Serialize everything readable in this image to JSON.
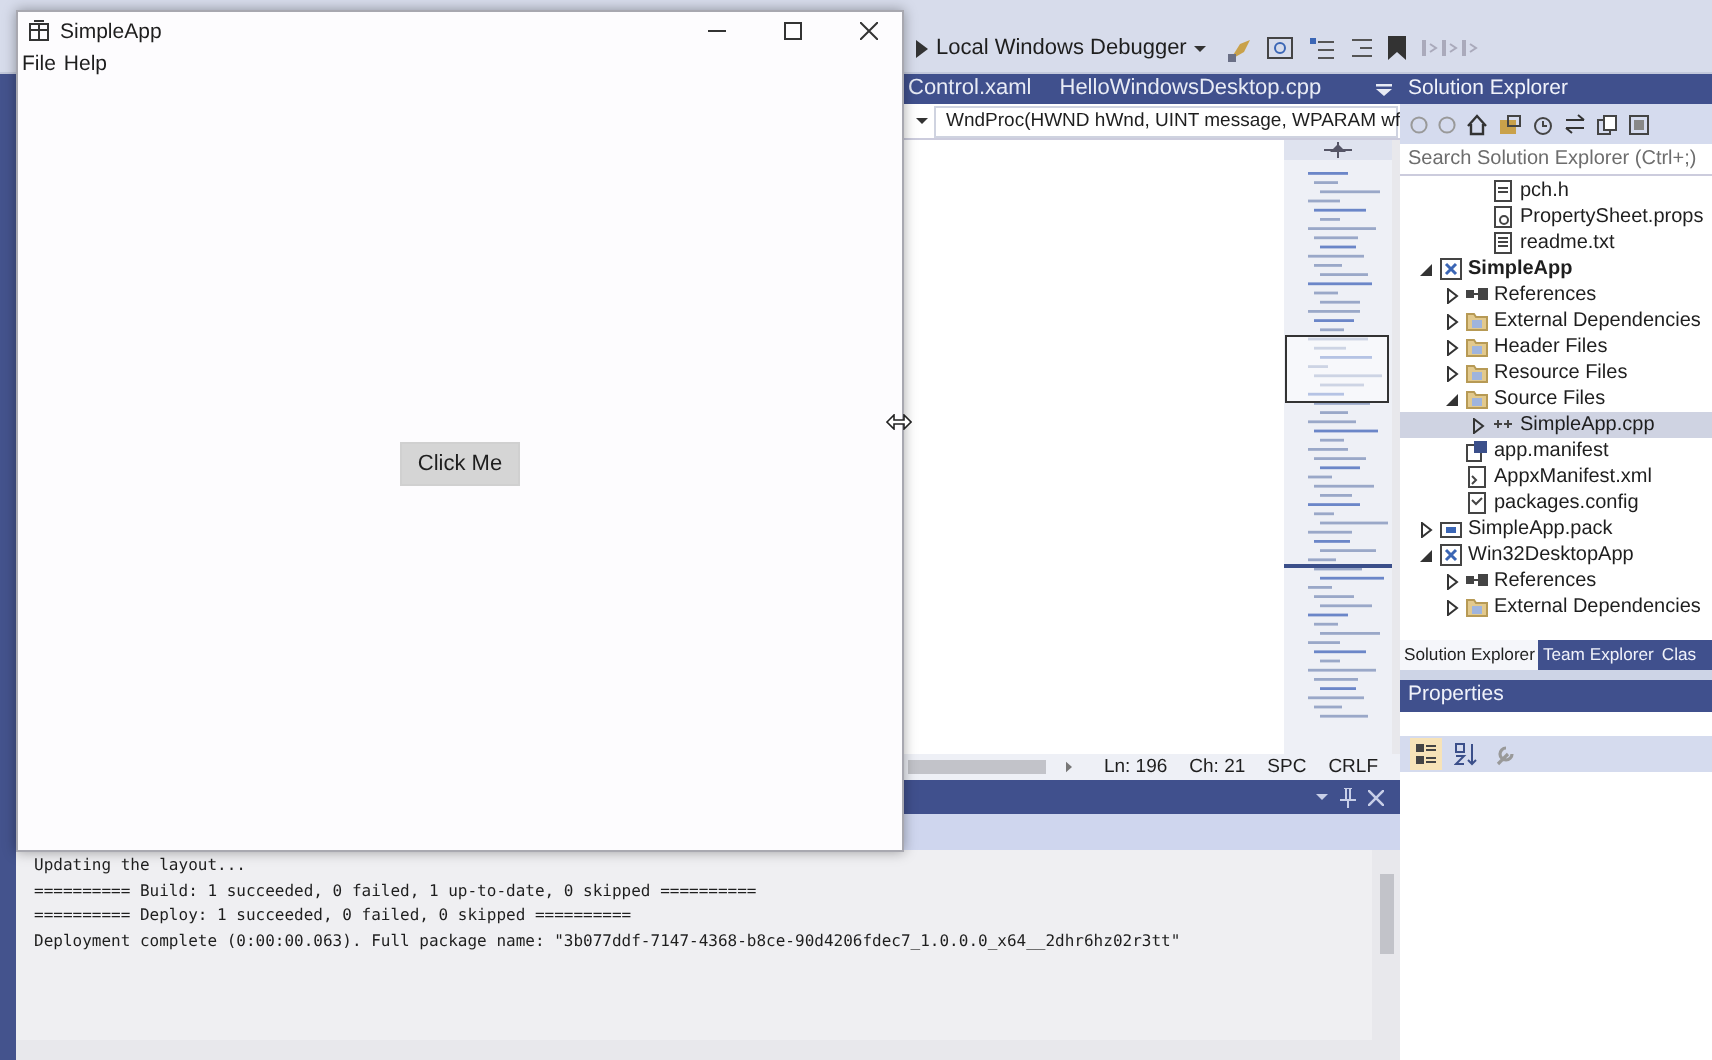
{
  "vs_toolbar": {
    "debugger": "Local Windows Debugger"
  },
  "editor": {
    "tabs": [
      {
        "label": "Control.xaml",
        "selected": false
      },
      {
        "label": "HelloWindowsDesktop.cpp",
        "selected": false
      }
    ],
    "function_dropdown": "WndProc(HWND hWnd, UINT message, WPARAM wf",
    "status": {
      "line": "Ln: 196",
      "column": "Ch: 21",
      "indent": "SPC",
      "line_ending": "CRLF"
    }
  },
  "output": {
    "lines": [
      "Updating the layout...",
      "========== Build: 1 succeeded, 0 failed, 1 up-to-date, 0 skipped ==========",
      "========== Deploy: 1 succeeded, 0 failed, 0 skipped ==========",
      "Deployment complete (0:00:00.063). Full package name: \"3b077ddf-7147-4368-b8ce-90d4206fdec7_1.0.0.0_x64__2dhr6hz02r3tt\""
    ]
  },
  "solution_explorer": {
    "title": "Solution Explorer",
    "search": {
      "placeholder": "Search Solution Explorer (Ctrl+;)"
    },
    "continued_items": [
      {
        "label": "pch.h",
        "kind": "header",
        "selected": false
      },
      {
        "label": "PropertySheet.props",
        "kind": "props",
        "selected": false
      },
      {
        "label": "readme.txt",
        "kind": "text",
        "selected": false
      }
    ],
    "items": [
      {
        "label": "SimpleApp",
        "kind": "project",
        "bold": true,
        "expanded": true,
        "selected": false,
        "children": [
          {
            "label": "References",
            "kind": "references",
            "expanded": false,
            "selected": false
          },
          {
            "label": "External Dependencies",
            "kind": "folder",
            "expanded": false,
            "selected": false
          },
          {
            "label": "Header Files",
            "kind": "folder",
            "expanded": false,
            "selected": false
          },
          {
            "label": "Resource Files",
            "kind": "folder",
            "expanded": false,
            "selected": false
          },
          {
            "label": "Source Files",
            "kind": "folder",
            "expanded": true,
            "selected": false,
            "children": [
              {
                "label": "SimpleApp.cpp",
                "kind": "cpp",
                "expanded": false,
                "selected": true
              }
            ]
          },
          {
            "label": "app.manifest",
            "kind": "manifest",
            "selected": false
          },
          {
            "label": "AppxManifest.xml",
            "kind": "xml",
            "selected": false
          },
          {
            "label": "packages.config",
            "kind": "config",
            "selected": false
          }
        ]
      },
      {
        "label": "SimpleApp.pack",
        "kind": "package",
        "bold": false,
        "expanded": false,
        "selected": false
      },
      {
        "label": "Win32DesktopApp",
        "kind": "project",
        "bold": false,
        "expanded": true,
        "selected": false,
        "children": [
          {
            "label": "References",
            "kind": "references",
            "expanded": false,
            "selected": false
          },
          {
            "label": "External Dependencies",
            "kind": "folder",
            "expanded": false,
            "selected": false
          }
        ]
      }
    ]
  },
  "side_tabs": [
    {
      "label": "Solution Explorer",
      "selected": true
    },
    {
      "label": "Team Explorer",
      "selected": false
    },
    {
      "label": "Clas",
      "selected": false
    }
  ],
  "properties": {
    "title": "Properties",
    "tools": [
      {
        "kind": "categorized",
        "selected": true
      },
      {
        "kind": "alphabetical",
        "selected": false
      },
      {
        "kind": "pages",
        "selected": false
      }
    ]
  },
  "app_window": {
    "title": "SimpleApp",
    "menu": [
      "File",
      "Help"
    ],
    "button": "Click Me"
  }
}
